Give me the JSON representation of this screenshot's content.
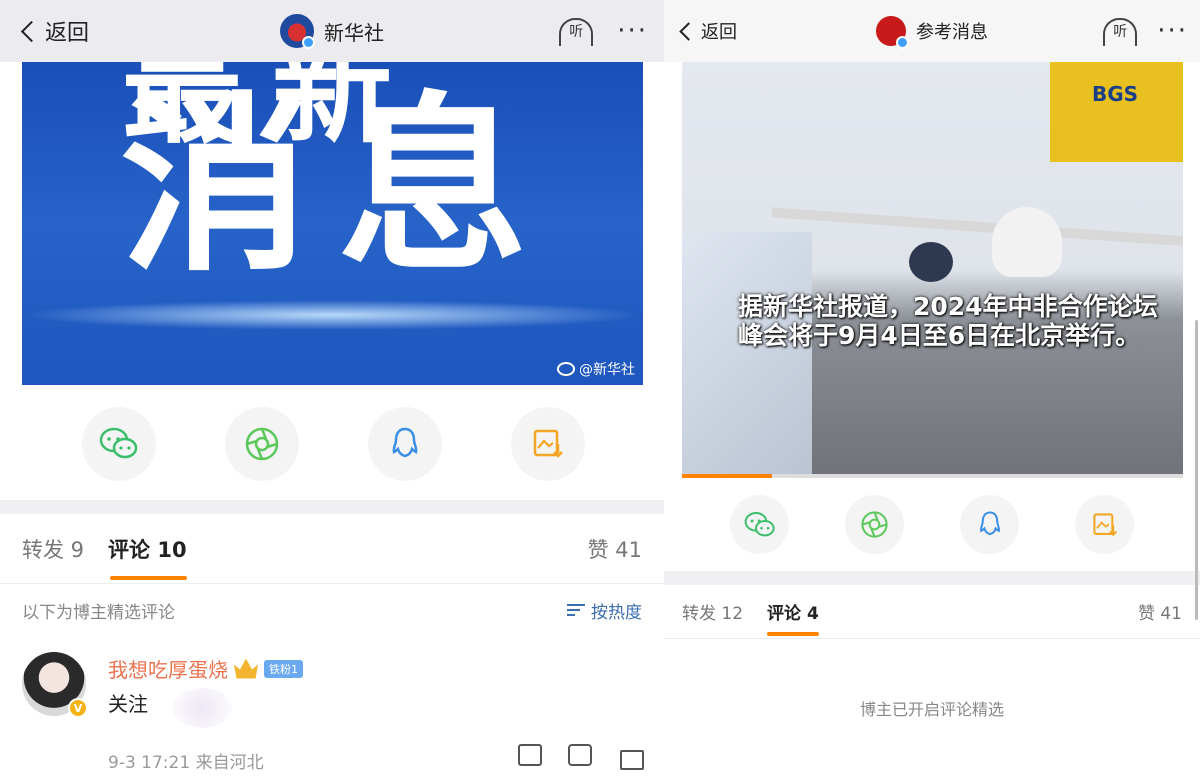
{
  "left": {
    "nav": {
      "back_label": "返回",
      "title": "新华社",
      "listen_label": "听",
      "more_label": "···"
    },
    "image": {
      "top_text": "最新",
      "main_text": "消息",
      "watermark": "@新华社"
    },
    "share_icons": [
      "wechat-icon",
      "moments-icon",
      "qq-icon",
      "save-image-icon"
    ],
    "tabs": {
      "repost_label": "转发 9",
      "comment_label": "评论 10",
      "like_label": "赞 41"
    },
    "subheader": {
      "text": "以下为博主精选评论",
      "sort_label": "按热度"
    },
    "comment": {
      "username": "我想吃厚蛋烧",
      "fan_badge": "铁粉1",
      "text": "关注",
      "meta": "9-3 17:21 来自河北",
      "verified_mark": "V"
    },
    "colors": {
      "accent": "#ff8200",
      "username": "#eb7350",
      "link": "#3c6eb0"
    }
  },
  "right": {
    "nav": {
      "back_label": "返回",
      "title": "参考消息",
      "listen_label": "听",
      "more_label": "···"
    },
    "video": {
      "caption": "据新华社报道，2024年中非合作论坛峰会将于9月4日至6日在北京举行。",
      "loader_text": "BGS",
      "progress": 0.18
    },
    "share_icons": [
      "wechat-icon",
      "moments-icon",
      "qq-icon",
      "save-image-icon"
    ],
    "tabs": {
      "repost_label": "转发 12",
      "comment_label": "评论 4",
      "like_label": "赞 41"
    },
    "empty_note": "博主已开启评论精选"
  }
}
